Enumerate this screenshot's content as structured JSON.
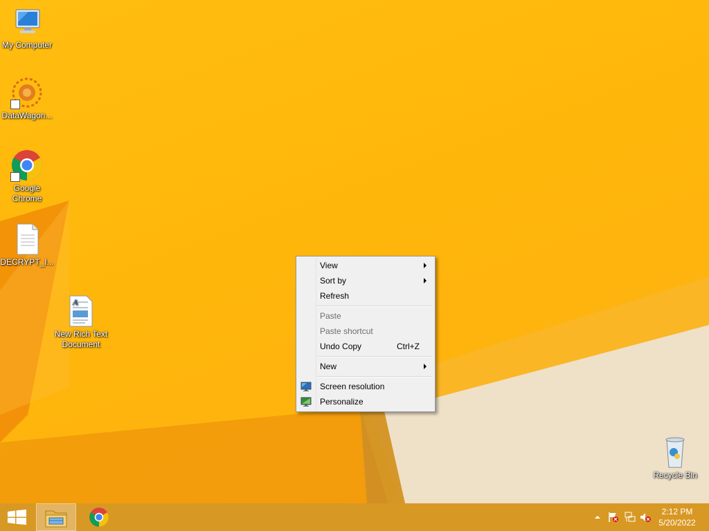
{
  "desktop": {
    "icons": [
      {
        "label": "My Computer",
        "icon": "my-computer-icon"
      },
      {
        "label": "DataWagon...",
        "icon": "datawagon-icon"
      },
      {
        "label": "Google Chrome",
        "icon": "chrome-icon"
      },
      {
        "label": "DECRYPT_I...",
        "icon": "text-file-icon"
      },
      {
        "label": "New Rich Text Document",
        "icon": "rich-text-document-icon"
      },
      {
        "label": "Recycle Bin",
        "icon": "recycle-bin-icon"
      }
    ]
  },
  "context_menu": {
    "view": "View",
    "sort_by": "Sort by",
    "refresh": "Refresh",
    "paste": "Paste",
    "paste_shortcut": "Paste shortcut",
    "undo_copy": "Undo Copy",
    "undo_copy_shortcut": "Ctrl+Z",
    "new": "New",
    "screen_resolution": "Screen resolution",
    "personalize": "Personalize"
  },
  "taskbar": {
    "start_icon": "windows-logo-icon",
    "pinned": [
      "file-explorer-icon",
      "chrome-icon"
    ],
    "tray": {
      "icons": [
        "show-hidden-icons-icon",
        "action-center-flag-icon",
        "network-icon",
        "volume-muted-icon"
      ],
      "time": "2:12 PM",
      "date": "5/20/2022"
    }
  },
  "colors": {
    "desktop_bg": "#ffb60a",
    "taskbar_bg": "#d89824",
    "menu_bg": "#f0f0f0"
  }
}
